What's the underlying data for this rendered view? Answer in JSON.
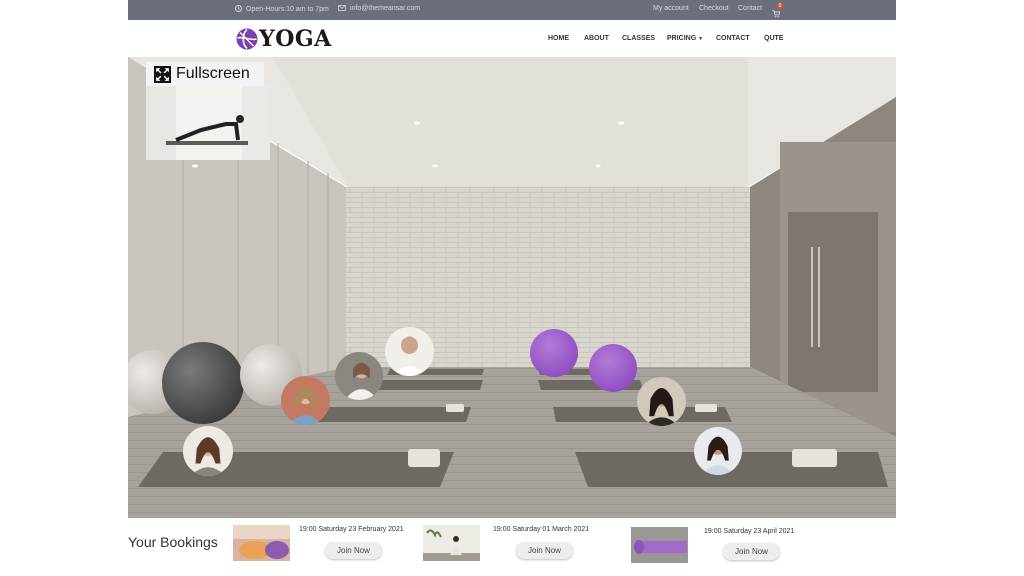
{
  "topbar": {
    "hours": "Open-Hours:10 am to 7pm",
    "email": "info@themeansar.com",
    "my_account": "My account",
    "checkout": "Checkout",
    "contact": "Contact",
    "cart_count": "0"
  },
  "brand": {
    "name": "YOGA",
    "accent": "#7a3fb0"
  },
  "nav": {
    "home": "HOME",
    "about": "ABOUT",
    "classes": "CLASSES",
    "pricing": "PRICING",
    "contact": "CONTACT",
    "quote": "QUTE"
  },
  "scene": {
    "fullscreen_label": "Fullscreen"
  },
  "bookings": {
    "title": "Your Bookings",
    "items": [
      {
        "date": "19:00 Saturday 23 February 2021",
        "button": "Join Now"
      },
      {
        "date": "19:00 Saturday 01 March  2021",
        "button": "Join Now"
      },
      {
        "date": "19:00 Saturday 23 April 2021",
        "button": "Join Now"
      }
    ]
  }
}
